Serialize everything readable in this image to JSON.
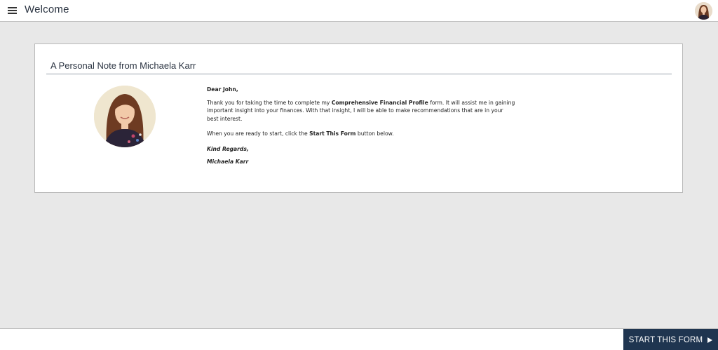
{
  "header": {
    "title": "Welcome",
    "menu_icon": "hamburger-menu-icon",
    "avatar_icon": "user-avatar"
  },
  "note": {
    "title": "A Personal Note from Michaela Karr",
    "greeting": "Dear John,",
    "p1_before": "Thank you for taking the time to complete my ",
    "p1_bold": "Comprehensive Financial Profile",
    "p1_after": " form. It will assist me in gaining important insight into your finances. With that insight, I will be able to make recommendations that are in your best interest.",
    "p2_before": "When you are ready to start, click the ",
    "p2_bold": "Start This Form",
    "p2_after": " button below.",
    "closing": "Kind Regards,",
    "signature": "Michaela Karr"
  },
  "footer": {
    "start_label": "START THIS FORM",
    "start_icon": "play-arrow-icon"
  },
  "colors": {
    "background": "#e8e8e8",
    "primary_button": "#1f3550",
    "title_text": "#2b3442"
  }
}
